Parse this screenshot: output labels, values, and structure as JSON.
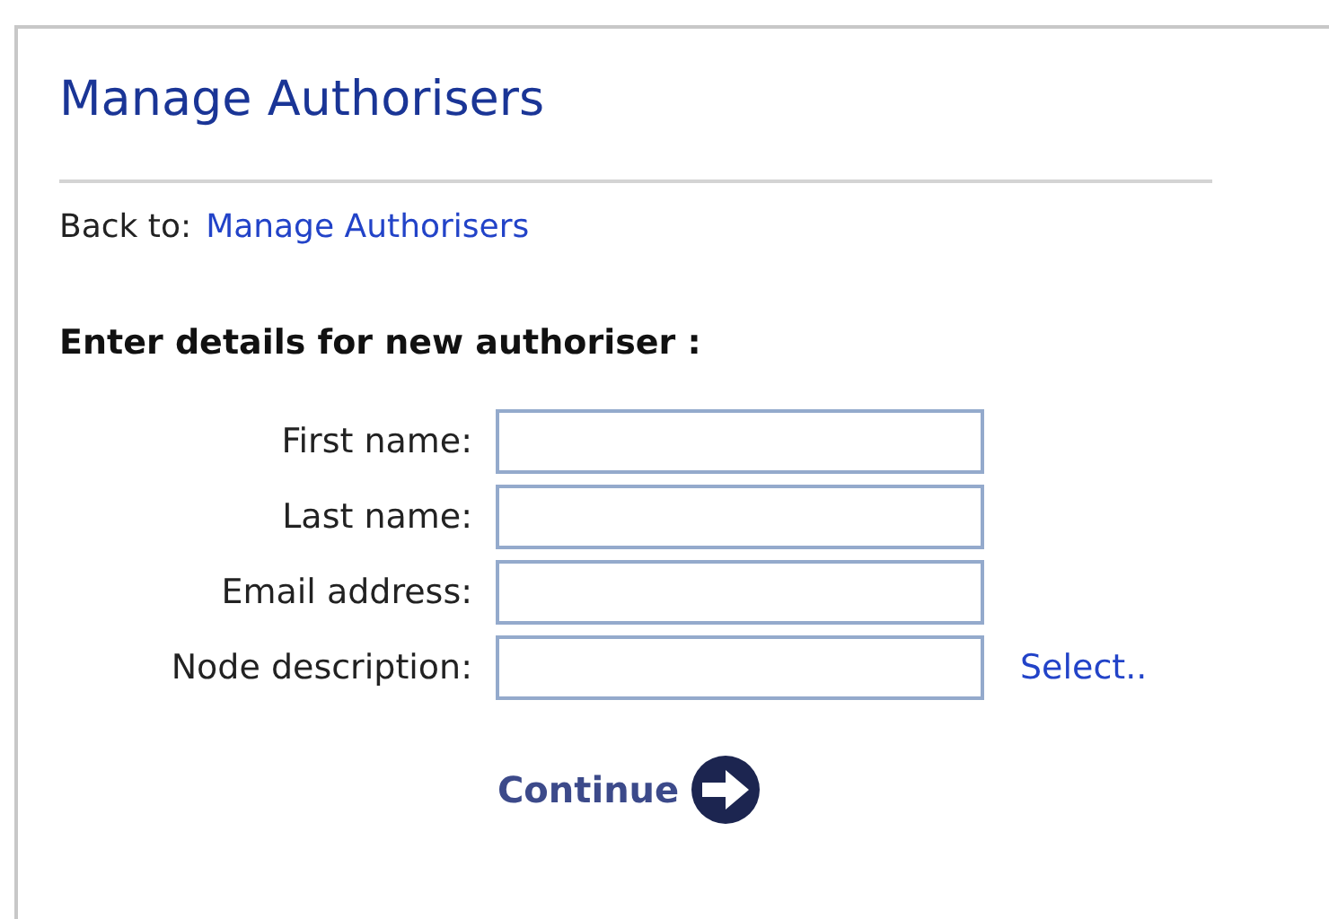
{
  "title": "Manage Authorisers",
  "back": {
    "label": "Back to:",
    "link": "Manage Authorisers"
  },
  "heading": "Enter details for new authoriser :",
  "fields": [
    {
      "label": "First name:"
    },
    {
      "label": "Last name:"
    },
    {
      "label": "Email address:"
    },
    {
      "label": "Node description:",
      "action": "Select.."
    }
  ],
  "submit": "Continue"
}
